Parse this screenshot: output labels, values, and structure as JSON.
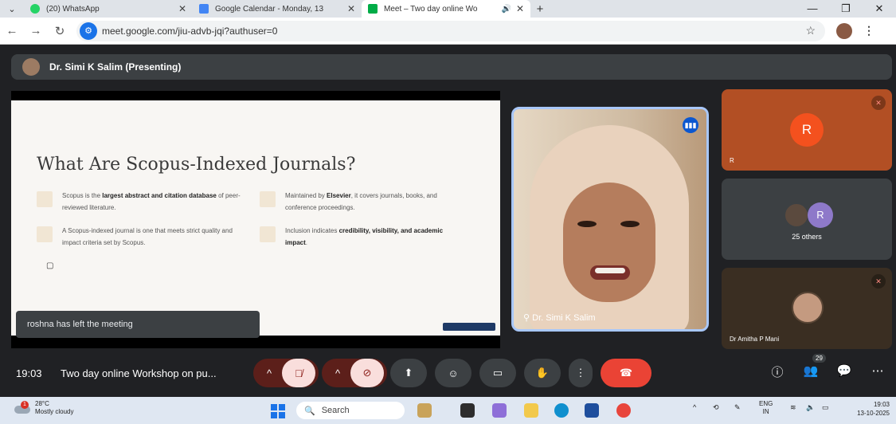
{
  "browser": {
    "tabs": [
      {
        "title": "(20) WhatsApp",
        "favicon_color": "#25d366"
      },
      {
        "title": "Google Calendar - Monday, 13",
        "favicon_color": "#4285f4"
      },
      {
        "title": "Meet – Two day online Wo",
        "favicon_color": "#00ac47"
      }
    ],
    "new_tab": "+",
    "url": "meet.google.com/jiu-advb-jqi?authuser=0"
  },
  "meet": {
    "presenter_label": "Dr. Simi K Salim (Presenting)",
    "slide": {
      "title": "What Are Scopus-Indexed Journals?",
      "bullets": [
        {
          "pre": "Scopus is the ",
          "bold": "largest abstract and citation database",
          "post": " of peer-reviewed literature."
        },
        {
          "pre": "Maintained by ",
          "bold": "Elsevier",
          "post": ", it covers journals, books, and conference proceedings."
        },
        {
          "pre": "A Scopus-indexed journal is one that meets strict quality and impact criteria set by Scopus.",
          "bold": "",
          "post": ""
        },
        {
          "pre": "Inclusion indicates ",
          "bold": "credibility, visibility, and academic impact",
          "post": "."
        }
      ]
    },
    "toast": "roshna has left the meeting",
    "main_video_name": "Dr. Simi K Salim",
    "tiles": {
      "r_initial": "R",
      "r_name": "R",
      "others_initial": "R",
      "others_label": "25 others",
      "amitha_name": "Dr Amitha P Mani"
    },
    "time": "19:03",
    "meeting_title": "Two day online Workshop on pu...",
    "participant_count": "29"
  },
  "taskbar": {
    "temp": "28°C",
    "weather": "Mostly cloudy",
    "weather_badge": "1",
    "search": "Search",
    "lang1": "ENG",
    "lang2": "IN",
    "time": "19:03",
    "date": "13-10-2025"
  }
}
